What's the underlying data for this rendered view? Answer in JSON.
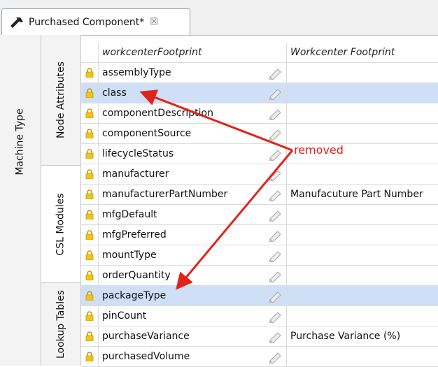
{
  "tab": {
    "title": "Purchased Component*",
    "close": "☒"
  },
  "left_tabs": {
    "machine_type": "Machine Type",
    "node_attributes": "Node Attributes",
    "csl_modules": "CSL Modules",
    "lookup_tables": "Lookup Tables"
  },
  "grid": {
    "header": {
      "name": "workcenterFootprint",
      "value": "Workcenter Footprint"
    },
    "rows": [
      {
        "name": "assemblyType",
        "value": ""
      },
      {
        "name": "class",
        "value": "",
        "selected": true
      },
      {
        "name": "componentDescription",
        "value": ""
      },
      {
        "name": "componentSource",
        "value": ""
      },
      {
        "name": "lifecycleStatus",
        "value": ""
      },
      {
        "name": "manufacturer",
        "value": ""
      },
      {
        "name": "manufacturerPartNumber",
        "value": "Manufacuture Part Number"
      },
      {
        "name": "mfgDefault",
        "value": ""
      },
      {
        "name": "mfgPreferred",
        "value": ""
      },
      {
        "name": "mountType",
        "value": ""
      },
      {
        "name": "orderQuantity",
        "value": ""
      },
      {
        "name": "packageType",
        "value": "",
        "selected": true
      },
      {
        "name": "pinCount",
        "value": ""
      },
      {
        "name": "purchaseVariance",
        "value": "Purchase Variance (%)"
      },
      {
        "name": "purchasedVolume",
        "value": ""
      }
    ]
  },
  "annotation": {
    "text": "removed",
    "color": "#e2231a"
  },
  "colors": {
    "selected_row": "#cfdff5",
    "lock": "#f0c419"
  },
  "icons": {
    "tab": "hammer-icon",
    "lock": "lock-icon",
    "edit": "pencil-icon"
  }
}
